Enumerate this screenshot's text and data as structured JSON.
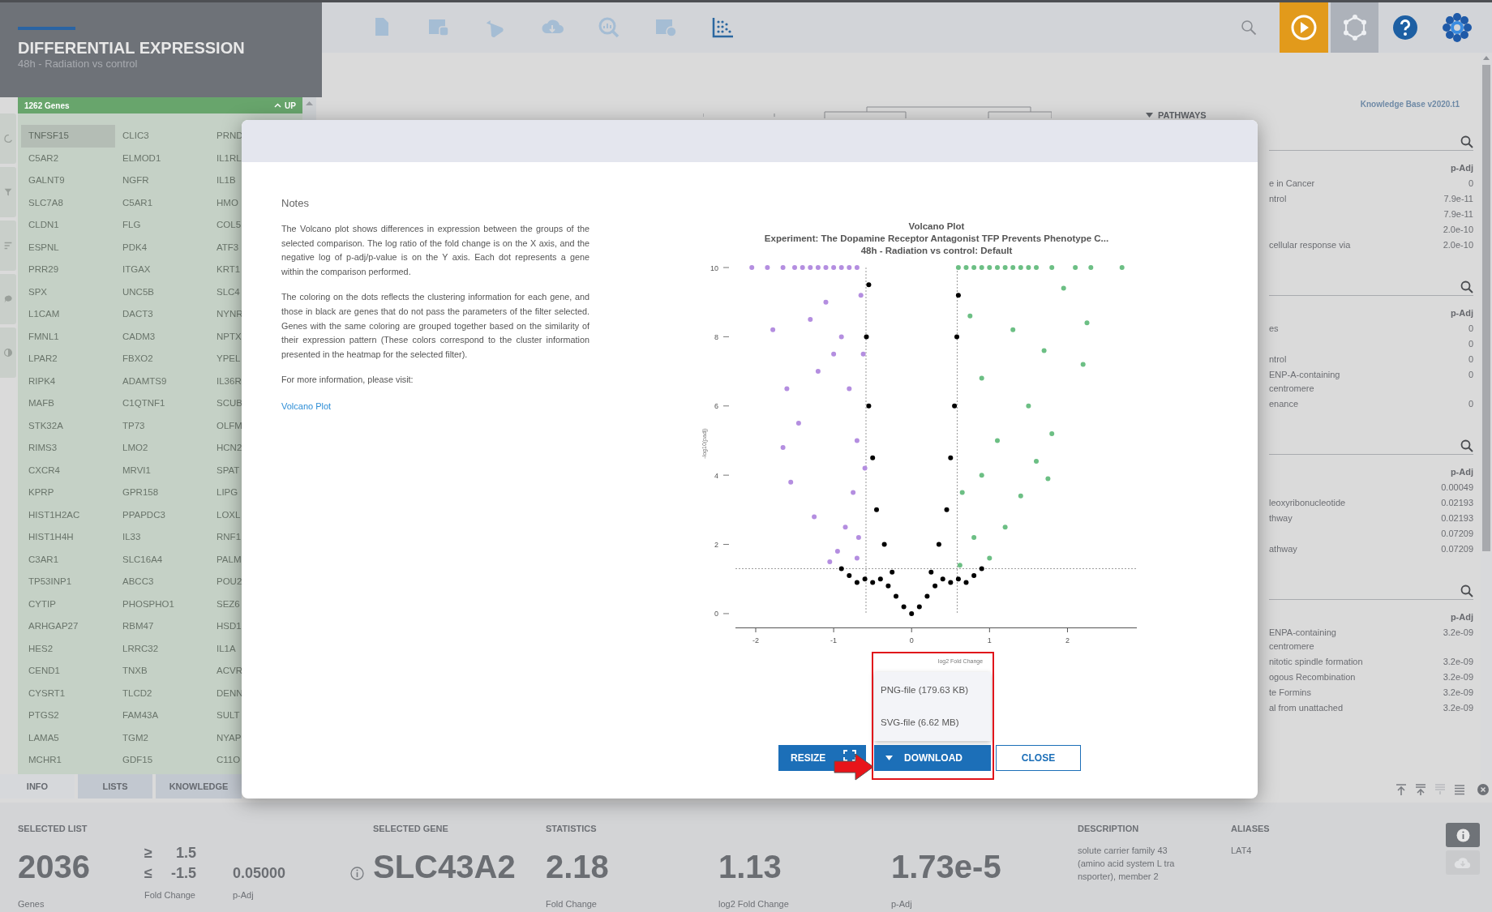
{
  "header": {
    "title": "DIFFERENTIAL EXPRESSION",
    "subtitle": "48h - Radiation vs control"
  },
  "toolbar": {
    "buttons": [
      {
        "selected": false
      },
      {
        "selected": false
      },
      {
        "selected": false
      },
      {
        "selected": false
      },
      {
        "selected": false
      },
      {
        "selected": false
      },
      {
        "selected": true
      }
    ]
  },
  "gene_list": {
    "count": "1262 Genes",
    "direction": "UP",
    "genes": [
      {
        "name": "TNFSF15",
        "selected": true
      },
      {
        "name": "CLIC3",
        "selected": false
      },
      {
        "name": "PRND",
        "selected": false
      },
      {
        "name": "C5AR2",
        "selected": false
      },
      {
        "name": "ELMOD1",
        "selected": false
      },
      {
        "name": "IL1RL",
        "selected": false
      },
      {
        "name": "GALNT9",
        "selected": false
      },
      {
        "name": "NGFR",
        "selected": false
      },
      {
        "name": "IL1B",
        "selected": false
      },
      {
        "name": "SLC7A8",
        "selected": false
      },
      {
        "name": "C5AR1",
        "selected": false
      },
      {
        "name": "HMO",
        "selected": false
      },
      {
        "name": "CLDN1",
        "selected": false
      },
      {
        "name": "FLG",
        "selected": false
      },
      {
        "name": "COL5",
        "selected": false
      },
      {
        "name": "ESPNL",
        "selected": false
      },
      {
        "name": "PDK4",
        "selected": false
      },
      {
        "name": "ATF3",
        "selected": false
      },
      {
        "name": "PRR29",
        "selected": false
      },
      {
        "name": "ITGAX",
        "selected": false
      },
      {
        "name": "KRT1",
        "selected": false
      },
      {
        "name": "SPX",
        "selected": false
      },
      {
        "name": "UNC5B",
        "selected": false
      },
      {
        "name": "SLC4",
        "selected": false
      },
      {
        "name": "L1CAM",
        "selected": false
      },
      {
        "name": "DACT3",
        "selected": false
      },
      {
        "name": "NYNR",
        "selected": false
      },
      {
        "name": "FMNL1",
        "selected": false
      },
      {
        "name": "CADM3",
        "selected": false
      },
      {
        "name": "NPTX",
        "selected": false
      },
      {
        "name": "LPAR2",
        "selected": false
      },
      {
        "name": "FBXO2",
        "selected": false
      },
      {
        "name": "YPEL",
        "selected": false
      },
      {
        "name": "RIPK4",
        "selected": false
      },
      {
        "name": "ADAMTS9",
        "selected": false
      },
      {
        "name": "IL36R",
        "selected": false
      },
      {
        "name": "MAFB",
        "selected": false
      },
      {
        "name": "C1QTNF1",
        "selected": false
      },
      {
        "name": "SCUB",
        "selected": false
      },
      {
        "name": "STK32A",
        "selected": false
      },
      {
        "name": "TP73",
        "selected": false
      },
      {
        "name": "OLFM",
        "selected": false
      },
      {
        "name": "RIMS3",
        "selected": false
      },
      {
        "name": "LMO2",
        "selected": false
      },
      {
        "name": "HCN2",
        "selected": false
      },
      {
        "name": "CXCR4",
        "selected": false
      },
      {
        "name": "MRVI1",
        "selected": false
      },
      {
        "name": "SPAT",
        "selected": false
      },
      {
        "name": "KPRP",
        "selected": false
      },
      {
        "name": "GPR158",
        "selected": false
      },
      {
        "name": "LIPG",
        "selected": false
      },
      {
        "name": "HIST1H2AC",
        "selected": false
      },
      {
        "name": "PPAPDC3",
        "selected": false
      },
      {
        "name": "LOXL",
        "selected": false
      },
      {
        "name": "HIST1H4H",
        "selected": false
      },
      {
        "name": "IL33",
        "selected": false
      },
      {
        "name": "RNF1",
        "selected": false
      },
      {
        "name": "C3AR1",
        "selected": false
      },
      {
        "name": "SLC16A4",
        "selected": false
      },
      {
        "name": "PALM",
        "selected": false
      },
      {
        "name": "TP53INP1",
        "selected": false
      },
      {
        "name": "ABCC3",
        "selected": false
      },
      {
        "name": "POU2",
        "selected": false
      },
      {
        "name": "CYTIP",
        "selected": false
      },
      {
        "name": "PHOSPHO1",
        "selected": false
      },
      {
        "name": "SEZ6",
        "selected": false
      },
      {
        "name": "ARHGAP27",
        "selected": false
      },
      {
        "name": "RBM47",
        "selected": false
      },
      {
        "name": "HSD1",
        "selected": false
      },
      {
        "name": "HES2",
        "selected": false
      },
      {
        "name": "LRRC32",
        "selected": false
      },
      {
        "name": "IL1A",
        "selected": false
      },
      {
        "name": "CEND1",
        "selected": false
      },
      {
        "name": "TNXB",
        "selected": false
      },
      {
        "name": "ACVR",
        "selected": false
      },
      {
        "name": "CYSRT1",
        "selected": false
      },
      {
        "name": "TLCD2",
        "selected": false
      },
      {
        "name": "DENN",
        "selected": false
      },
      {
        "name": "PTGS2",
        "selected": false
      },
      {
        "name": "FAM43A",
        "selected": false
      },
      {
        "name": "SULT",
        "selected": false
      },
      {
        "name": "LAMA5",
        "selected": false
      },
      {
        "name": "TGM2",
        "selected": false
      },
      {
        "name": "NYAP",
        "selected": false
      },
      {
        "name": "MCHR1",
        "selected": false
      },
      {
        "name": "GDF15",
        "selected": false
      },
      {
        "name": "C11O",
        "selected": false
      }
    ]
  },
  "side_tabs": [
    {
      "label": "INFO",
      "selected": true
    },
    {
      "label": "LISTS",
      "selected": false
    },
    {
      "label": "KNOWLEDGE",
      "selected": false
    }
  ],
  "right_panel": {
    "pathways_label": "PATHWAYS",
    "version": "Knowledge Base v2020.t1",
    "sections": [
      {
        "column": "p-Adj",
        "rows": [
          {
            "term": "e in Cancer",
            "p_adj": "0"
          },
          {
            "term": "ntrol",
            "p_adj": "7.9e-11"
          },
          {
            "p_adj": "7.9e-11"
          },
          {
            "p_adj": "2.0e-10"
          },
          {
            "term": "cellular response via",
            "p_adj": "2.0e-10"
          }
        ]
      },
      {
        "column": "p-Adj",
        "rows": [
          {
            "term": "es",
            "p_adj": "0"
          },
          {
            "p_adj": "0"
          },
          {
            "term": "ntrol",
            "p_adj": "0"
          },
          {
            "term": "ENP-A-containing\ncentromere",
            "p_adj": "0"
          },
          {
            "term": "enance",
            "p_adj": "0"
          }
        ]
      },
      {
        "column": "p-Adj",
        "rows": [
          {
            "p_adj": "0.00049"
          },
          {
            "term": "leoxyribonucleotide",
            "p_adj": "0.02193"
          },
          {
            "term": "thway",
            "p_adj": "0.02193"
          },
          {
            "p_adj": "0.07209"
          },
          {
            "term": "athway",
            "p_adj": "0.07209"
          }
        ]
      },
      {
        "column": "p-Adj",
        "rows": [
          {
            "term": "ENPA-containing\ncentromere",
            "p_adj": "3.2e-09"
          },
          {
            "term": "nitotic spindle formation",
            "p_adj": "3.2e-09"
          },
          {
            "term": "ogous Recombination",
            "p_adj": "3.2e-09"
          },
          {
            "term": "te Formins",
            "p_adj": "3.2e-09"
          },
          {
            "term": "al from unattached",
            "p_adj": "3.2e-09"
          }
        ]
      }
    ]
  },
  "dialog": {
    "notes_title": "Notes",
    "paragraphs": [
      "The Volcano plot shows differences in expression between the groups of the selected comparison. The log ratio of the fold change is on the X axis, and the negative log of p-adj/p-value is on the Y axis. Each dot represents a gene within the comparison performed.",
      "The coloring on the dots reflects the clustering information for each gene, and those in black are genes that do not pass the parameters of the filter selected. Genes with the same coloring are grouped together based on the similarity of their expression pattern (These colors correspond to the cluster information presented in the heatmap for the selected filter).",
      "For more information, please visit:"
    ],
    "link": "Volcano Plot",
    "chart_data": {
      "type": "scatter",
      "title": "Volcano Plot\nExperiment: The Dopamine Receptor Antagonist TFP Prevents Phenotype C...\n48h - Radiation vs control: Default",
      "xlabel": "log2 Fold Change",
      "ylabel": "-log10(padj)",
      "xlim": [
        -2.26,
        2.89
      ],
      "ylim": [
        -0.4,
        10
      ],
      "xticks": [
        -2,
        -1,
        0,
        1,
        2
      ],
      "yticks": [
        0,
        2,
        4,
        6,
        8,
        10
      ],
      "ref_lines": [
        {
          "axis": "y",
          "value": 1.3
        },
        {
          "axis": "x",
          "value": -0.585
        },
        {
          "axis": "x",
          "value": 0.585
        }
      ],
      "series": [
        {
          "color": "#b48ee0",
          "x": [
            -2.05,
            -1.85,
            -1.65,
            -1.5,
            -1.4,
            -1.3,
            -1.2,
            -1.1,
            -1.0,
            -0.9,
            -0.8,
            -0.7,
            -1.78,
            -1.6,
            -1.65,
            -1.55,
            -1.45,
            -1.3,
            -1.2,
            -1.1,
            -1.0,
            -0.9,
            -0.8,
            -0.7,
            -0.65,
            -0.75,
            -0.85,
            -0.95,
            -1.05,
            -0.7,
            -1.25,
            -0.62,
            -0.68,
            -0.6
          ],
          "values": [
            10,
            10,
            10,
            10,
            10,
            10,
            10,
            10,
            10,
            10,
            10,
            10,
            8.2,
            6.5,
            4.8,
            3.8,
            5.5,
            8.5,
            7.0,
            9.0,
            7.5,
            8.0,
            6.5,
            5.0,
            9.2,
            3.5,
            2.5,
            1.8,
            1.5,
            1.6,
            2.8,
            7.5,
            2.2,
            4.2
          ]
        },
        {
          "color": "#000000",
          "x": [
            0,
            -0.1,
            0.1,
            -0.2,
            0.2,
            -0.3,
            0.3,
            -0.4,
            0.4,
            -0.5,
            0.5,
            -0.7,
            0.7,
            -0.8,
            0.8,
            -0.9,
            0.9,
            -0.35,
            0.35,
            -0.45,
            0.45,
            -0.5,
            0.5,
            -0.55,
            0.55,
            -0.58,
            0.58,
            -0.55,
            0.6,
            -0.25,
            0.25,
            -0.6,
            0.6
          ],
          "values": [
            0,
            0.2,
            0.2,
            0.5,
            0.5,
            0.8,
            0.8,
            1.0,
            1.0,
            0.9,
            0.9,
            0.9,
            0.9,
            1.1,
            1.1,
            1.3,
            1.3,
            2.0,
            2.0,
            3.0,
            3.0,
            4.5,
            4.5,
            6.0,
            6.0,
            8.0,
            8.0,
            9.5,
            9.2,
            1.2,
            1.2,
            1.0,
            1.0
          ]
        },
        {
          "color": "#6cbf84",
          "x": [
            0.6,
            0.7,
            0.8,
            0.9,
            1.0,
            1.1,
            1.2,
            1.3,
            1.4,
            1.5,
            1.6,
            1.8,
            2.1,
            2.3,
            2.7,
            2.25,
            2.2,
            1.95,
            1.7,
            1.5,
            1.3,
            1.1,
            0.9,
            0.75,
            0.65,
            0.8,
            1.0,
            1.2,
            1.4,
            1.6,
            1.8,
            0.62,
            0.9,
            1.75
          ],
          "values": [
            10,
            10,
            10,
            10,
            10,
            10,
            10,
            10,
            10,
            10,
            10,
            10,
            10,
            10,
            10,
            8.4,
            7.2,
            9.4,
            7.6,
            6.0,
            8.2,
            5.0,
            6.8,
            8.6,
            3.5,
            2.2,
            1.6,
            2.5,
            3.4,
            4.4,
            5.2,
            1.4,
            4.0,
            3.9
          ]
        }
      ]
    },
    "download_menu": [
      "PNG-file (179.63 KB)",
      "SVG-file (6.62 MB)"
    ],
    "buttons": [
      {
        "label": "RESIZE",
        "kind": "resize"
      },
      {
        "label": "DOWNLOAD",
        "kind": "download"
      },
      {
        "label": "CLOSE",
        "kind": "close"
      }
    ]
  },
  "summary": {
    "selected_list": {
      "label": "SELECTED LIST",
      "count": "2036",
      "count_caption": "Genes",
      "thresholds": [
        {
          "symbol": "≥",
          "value": "1.5"
        },
        {
          "symbol": "≤",
          "value": "-1.5"
        }
      ],
      "fold_caption": "Fold Change",
      "padj": "0.05000",
      "padj_caption": "p-Adj"
    },
    "selected_gene": {
      "label": "SELECTED GENE",
      "name": "SLC43A2"
    },
    "statistics": {
      "label": "STATISTICS",
      "items": [
        {
          "value": "2.18",
          "caption": "Fold Change"
        },
        {
          "value": "1.13",
          "caption": "log2 Fold Change"
        },
        {
          "value": "1.73e-5",
          "caption": "p-Adj"
        }
      ]
    },
    "description": {
      "label": "DESCRIPTION",
      "text": "solute carrier family 43\n(amino acid system L tra\nnsporter), member 2"
    },
    "aliases": {
      "label": "ALIASES",
      "text": "LAT4"
    }
  }
}
